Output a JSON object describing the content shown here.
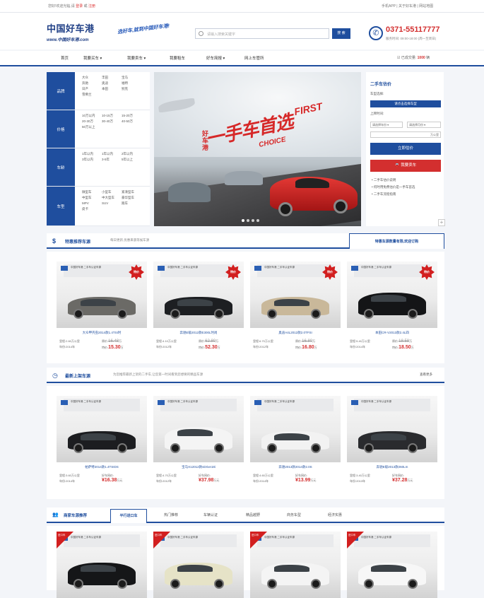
{
  "topbar": {
    "welcome": "您好!欢迎光临,请",
    "login": "登录",
    "or": "或",
    "register": "注册",
    "right": "手机APP | 关于好车港 | 网站地图"
  },
  "header": {
    "logo_cn": "中国好车港",
    "logo_url": "www.中国好车港.com",
    "slogan": "选好车,就到中国好车港!",
    "search_placeholder": "请输入搜索关键字",
    "search_button": "搜 索",
    "phone": "0371-55117777",
    "hours": "服务时间: 09:00-18:00 (周一至周日)"
  },
  "nav": {
    "items": [
      "首页",
      "我要买车 ▾",
      "我要卖车 ▾",
      "我要租车",
      "好车简报 ▾",
      "网上车管所"
    ],
    "count_prefix": "已成交量:",
    "count": "1000",
    "count_unit": "辆"
  },
  "filter": {
    "rows": [
      {
        "label": "品牌",
        "options": [
          "大众",
          "丰田",
          "宝马",
          "奔驰",
          "奥迪",
          "福特",
          "日产",
          "本田",
          "别克",
          "雪佛兰"
        ]
      },
      {
        "label": "价格",
        "options": [
          "10万以内",
          "10-15万",
          "15-20万",
          "20-30万",
          "30-40万",
          "40-50万",
          "50万以上"
        ]
      },
      {
        "label": "车龄",
        "options": [
          "1年以内",
          "1年以内",
          "2年以内",
          "3年以内",
          "3-5年",
          "5年以上"
        ]
      },
      {
        "label": "车型",
        "options": [
          "微型车",
          "小型车",
          "紧凑型车",
          "中型车",
          "中大型车",
          "豪华型车",
          "MPV",
          "SUV",
          "跑车",
          "皮卡"
        ]
      }
    ]
  },
  "banner": {
    "left_text": "好车港",
    "title": "一手车首选",
    "en1": "FIRST",
    "en2": "CHOICE"
  },
  "estimate": {
    "title": "二手车估价",
    "brand_label": "车型选择:",
    "brand_select": "请点击选择车型",
    "date_label": "上牌时间:",
    "year": "请选择年份",
    "month": "请选择月份",
    "mileage_unit": "万公里",
    "estimate_button": "立即估价",
    "sell_button": "我要卖车",
    "tips": [
      "二手车估价说明",
      "何时用免费估价是一手车首选",
      "二手车流程指南"
    ]
  },
  "section1": {
    "icon": "$",
    "title": "特惠推荐车源",
    "subtitle": "每日更新,优惠来袭等候车源",
    "tab": "特惠车源数量有限,欢迎订购"
  },
  "featured": [
    {
      "name": "大众甲壳虫2014款1.4TSI时",
      "mileage": "2.60万公里",
      "year": "2014年",
      "old_price": "16.48",
      "new_price": "15.30",
      "unit": "万",
      "badge": "特价",
      "color": "#6b6a66"
    },
    {
      "name": "奔驰E级2012款E300L时尚",
      "mileage": "4.10万公里",
      "year": "2012年",
      "old_price": "62.80",
      "new_price": "52.30",
      "unit": "万",
      "badge": "特价",
      "color": "#1d1f22"
    },
    {
      "name": "奥迪A4L2012款2.0TFSI",
      "mileage": "6.70万公里",
      "year": "2012年",
      "old_price": "16.80",
      "new_price": "16.80",
      "unit": "万",
      "badge": "特价",
      "color": "#c9b89a"
    },
    {
      "name": "本田CR-V2013款2.4L四",
      "mileage": "5.40万公里",
      "year": "2014年",
      "old_price": "18.58",
      "new_price": "18.50",
      "unit": "万",
      "badge": "特价",
      "color": "#141517"
    }
  ],
  "section2": {
    "icon": "◷",
    "title": "最新上架车源",
    "subtitle": "为您推荐最新上架的二手车,让您第一时间看到您想要的精品车源",
    "more": "查看更多"
  },
  "latest": [
    {
      "name": "帕萨特2014款1.4TSIDS",
      "mileage": "3.60万公里",
      "year": "2014年",
      "price_label": "好车网价:",
      "price": "¥16.38",
      "unit": "万元",
      "color": "#1c1d20"
    },
    {
      "name": "宝马X12012款sDrive18i",
      "mileage": "4.70万公里",
      "year": "2012年",
      "price_label": "好车网价:",
      "price": "¥37.98",
      "unit": "万元",
      "color": "#f4f4f4"
    },
    {
      "name": "奔驰2013款2014款2.0S",
      "mileage": "4.60万公里",
      "year": "2014年",
      "price_label": "好车网价:",
      "price": "¥13.99",
      "unit": "万元",
      "color": "#f2f2f2"
    },
    {
      "name": "奔驰E级2013款260Lm",
      "mileage": "3.40万公里",
      "year": "2013年",
      "price_label": "好车网价:",
      "price": "¥37.28",
      "unit": "万元",
      "color": "#2a2b2e"
    }
  ],
  "section3": {
    "icon": "👥",
    "title": "商家车源推荐",
    "tabs": [
      "平行进口车",
      "热门推荐",
      "车辆认证",
      "精品越野",
      "商务车型",
      "经济实惠"
    ]
  },
  "dealer": [
    {
      "badge": "进口车",
      "color": "#151618"
    },
    {
      "badge": "进口车",
      "color": "#e6e3c7"
    },
    {
      "badge": "进口车",
      "color": "#f4f4f4"
    },
    {
      "badge": "进口车",
      "color": "#f7f7f7"
    }
  ],
  "card_common": {
    "dealer_text": "中国好车港 二手车认证车源",
    "mileage_label": "里程:",
    "year_label": "年份:",
    "orig_label": "原价:",
    "sale_label": "特价:"
  }
}
